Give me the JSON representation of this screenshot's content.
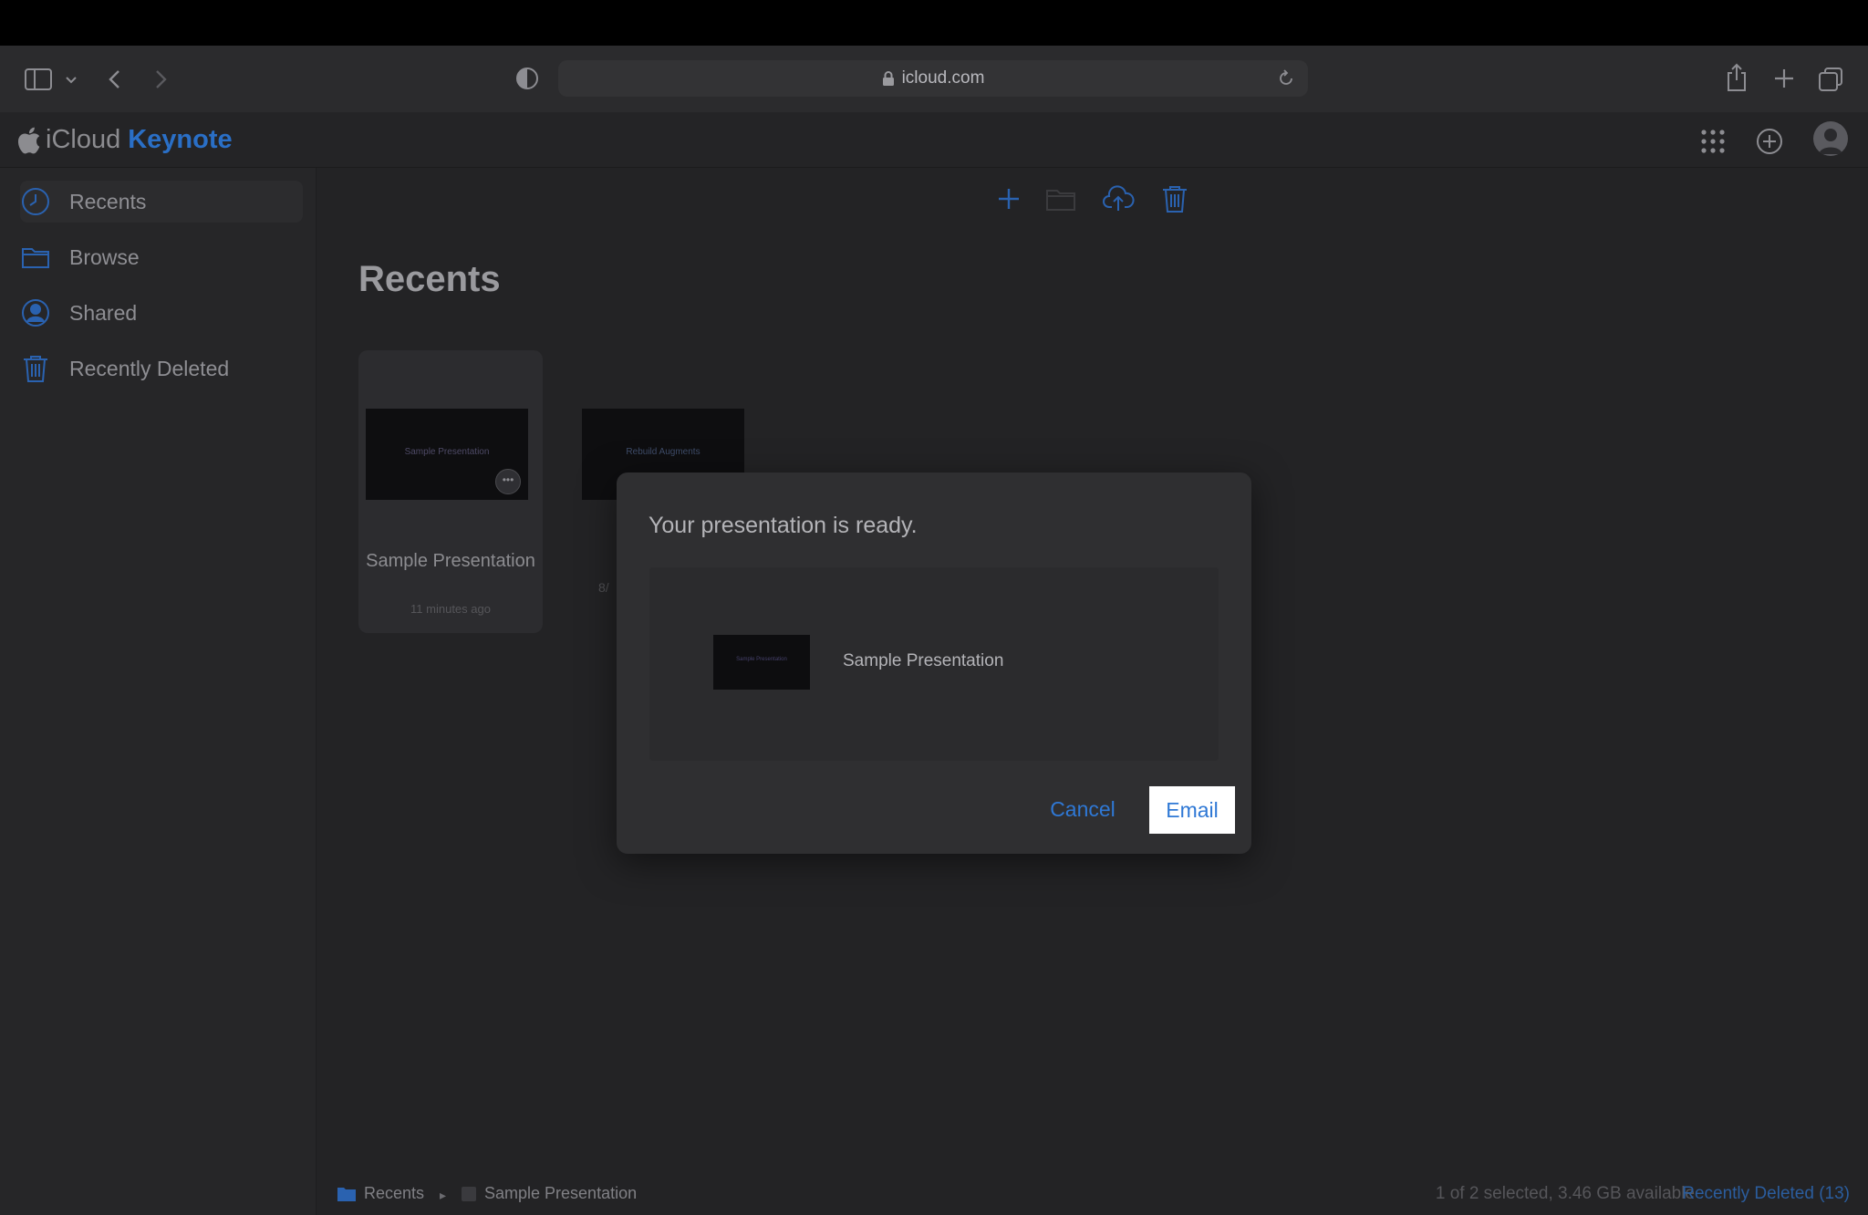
{
  "browser": {
    "url": "icloud.com"
  },
  "app": {
    "brand_icloud": "iCloud",
    "brand_app": "Keynote"
  },
  "sidebar": {
    "items": [
      {
        "label": "Recents",
        "icon": "clock-icon"
      },
      {
        "label": "Browse",
        "icon": "folder-icon"
      },
      {
        "label": "Shared",
        "icon": "person-icon"
      },
      {
        "label": "Recently Deleted",
        "icon": "trash-icon"
      }
    ]
  },
  "main": {
    "title": "Recents",
    "files": [
      {
        "name": "Sample Presentation",
        "time": "11 minutes ago",
        "thumb_text": "Sample Presentation"
      },
      {
        "name": "",
        "thumb_text": "Rebuild Augments"
      }
    ],
    "partial_card_text": "8/"
  },
  "status": {
    "crumb_1": "Recents",
    "crumb_2": "Sample Presentation",
    "text": "1 of 2 selected, 3.46 GB available",
    "link": "Recently Deleted (13)"
  },
  "dialog": {
    "title": "Your presentation is ready.",
    "file_name": "Sample Presentation",
    "thumb_text": "Sample Presentation",
    "cancel_label": "Cancel",
    "email_label": "Email"
  },
  "colors": {
    "accent": "#2f78d5",
    "background": "#232325"
  }
}
